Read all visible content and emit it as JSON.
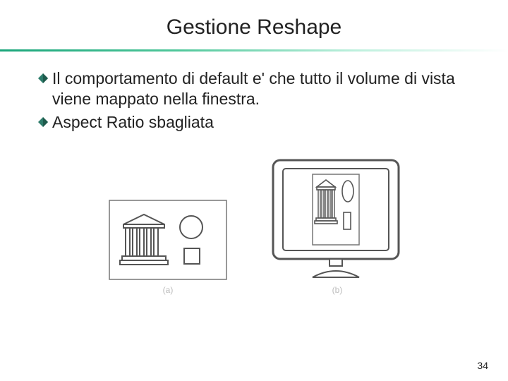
{
  "title": "Gestione Reshape",
  "bullets": [
    "Il comportamento di default e' che tutto il volume di vista viene mappato nella finestra.",
    "Aspect Ratio sbagliata"
  ],
  "figure_labels": {
    "a": "(a)",
    "b": "(b)"
  },
  "page_number": "34",
  "colors": {
    "bullet_icon": "#2d7c6b",
    "accent_start": "#1aa57a"
  }
}
